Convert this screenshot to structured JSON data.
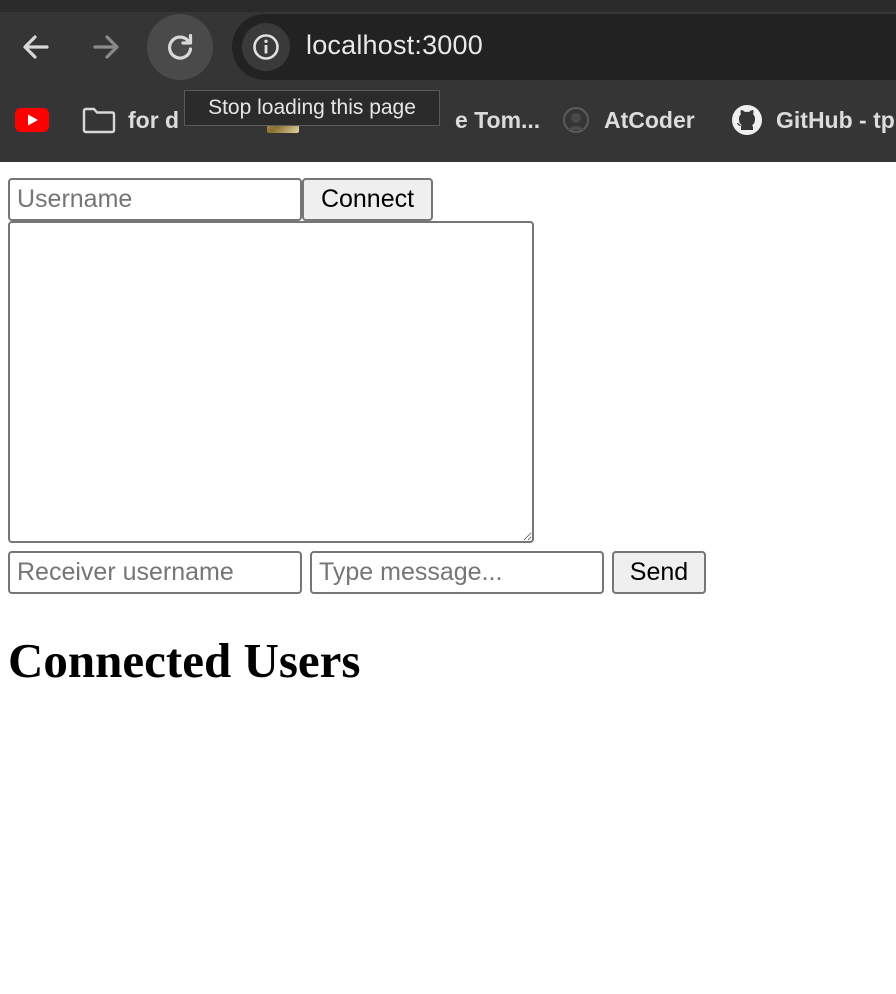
{
  "browser": {
    "url": "localhost:3000",
    "tooltip": "Stop loading this page",
    "nav_icons": [
      "back-arrow-icon",
      "forward-arrow-icon",
      "reload-icon"
    ],
    "bookmarks": [
      {
        "label": "",
        "icon": "youtube-icon"
      },
      {
        "label": "for d",
        "icon": "folder-icon"
      },
      {
        "label": "e Tom...",
        "icon": "thumbnail-icon"
      },
      {
        "label": "AtCoder",
        "icon": "atcoder-icon"
      },
      {
        "label": "GitHub - tp",
        "icon": "github-icon"
      }
    ],
    "colors": {
      "chrome": "#353535",
      "omnibox": "#222222",
      "youtube_red": "#ff0000"
    }
  },
  "page": {
    "username_placeholder": "Username",
    "connect_label": "Connect",
    "receiver_placeholder": "Receiver username",
    "message_placeholder": "Type message...",
    "send_label": "Send",
    "heading": "Connected Users"
  }
}
